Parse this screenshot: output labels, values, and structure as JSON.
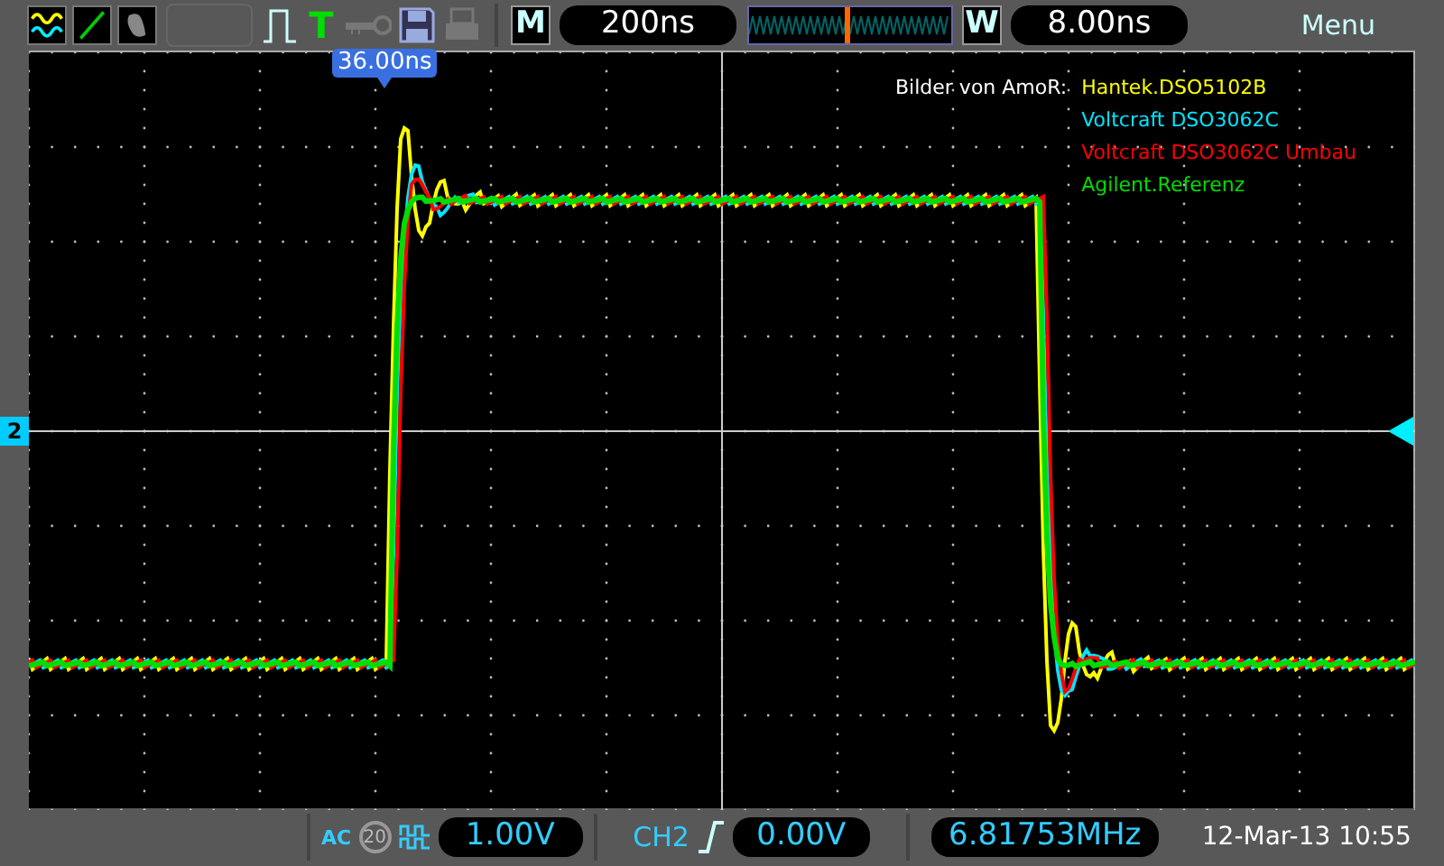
{
  "top_bar": {
    "mode_letter": "M",
    "timebase": "200ns",
    "window_letter": "W",
    "window_time": "8.00ns",
    "window_position": {
      "level": 0.47
    },
    "menu": "Menu",
    "trigger_letter": "T"
  },
  "plot": {
    "trigger_position": "36.00ns",
    "channel_marker": "2",
    "legend_title": "Bilder von AmoR:",
    "traces": [
      {
        "name": "Hantek.DSO5102B",
        "color": "#ffff00"
      },
      {
        "name": "Voltcraft DSO3062C",
        "color": "#00e5ff"
      },
      {
        "name": "Voltcraft DSO3062C Umbau",
        "color": "#ff0000"
      },
      {
        "name": "Agilent.Referenz",
        "color": "#00dd00"
      }
    ]
  },
  "bottom_bar": {
    "coupling": "AC",
    "bandwidth_limit": {
      "label": "20",
      "on": false
    },
    "volts_per_div": "1.00V",
    "trigger_source": "CH2",
    "trigger_level": "0.00V",
    "frequency": "6.81753MHz",
    "datetime": "12-Mar-13 10:55"
  }
}
